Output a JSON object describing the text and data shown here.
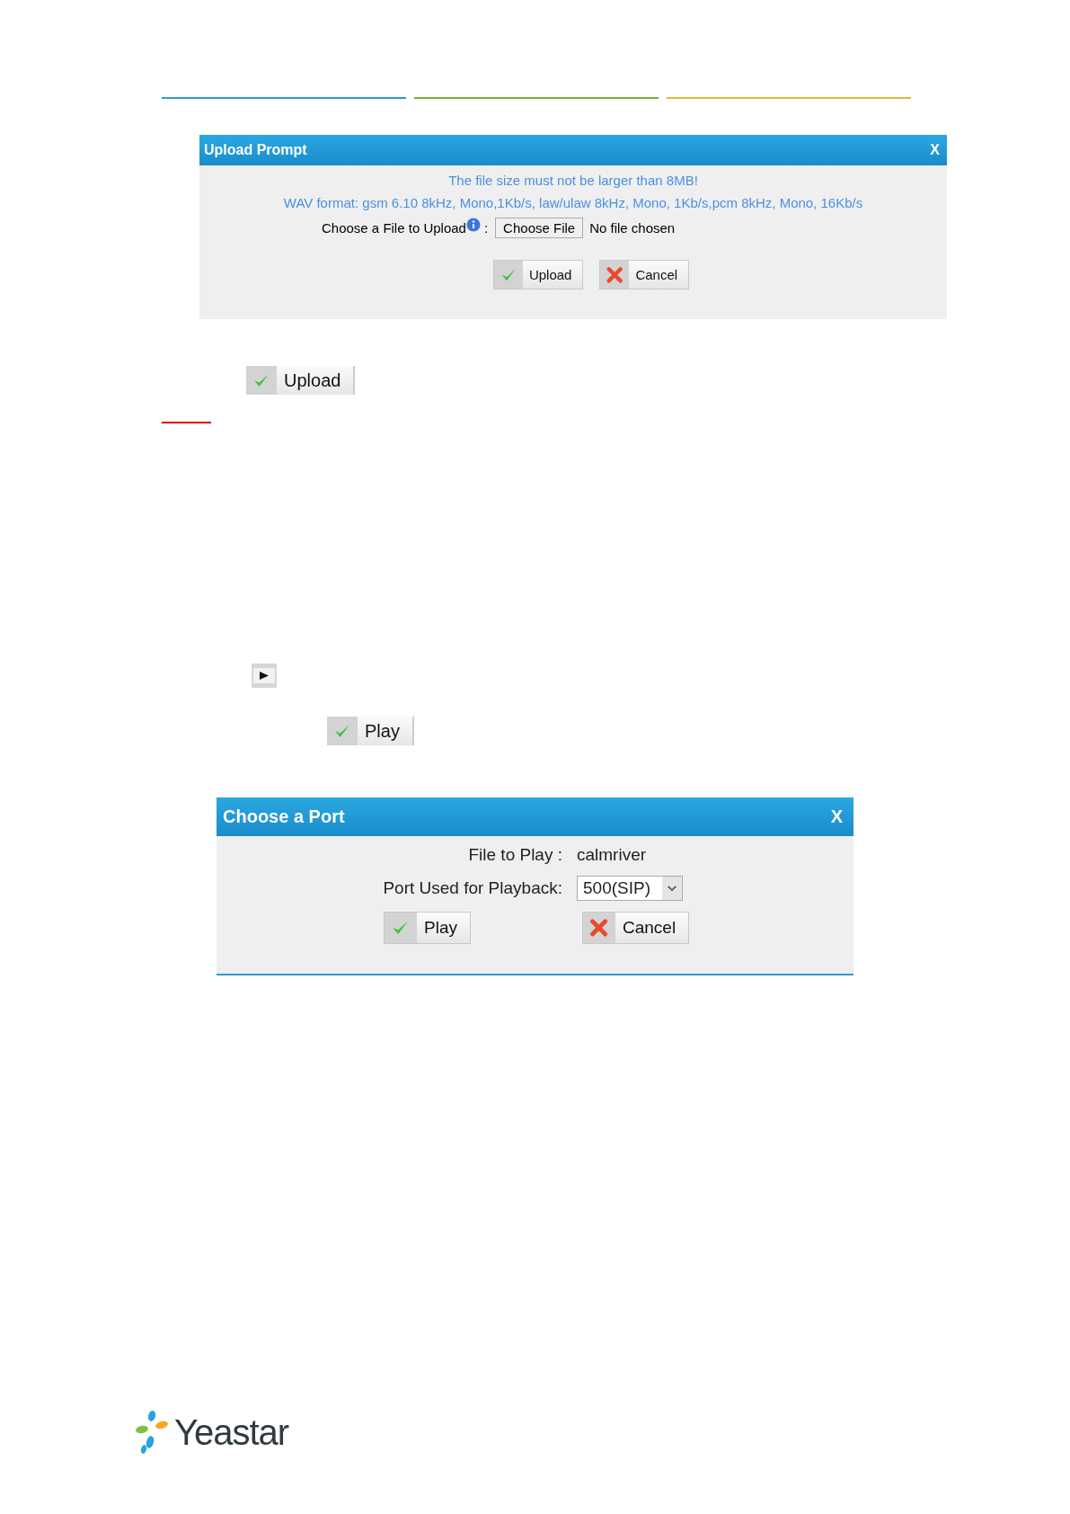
{
  "upload_prompt": {
    "title": "Upload Prompt",
    "close": "X",
    "notes": [
      "The file size must not be larger than 8MB!",
      "WAV format: gsm 6.10 8kHz, Mono,1Kb/s, law/ulaw 8kHz, Mono, 1Kb/s,pcm 8kHz, Mono, 16Kb/s"
    ],
    "file_label": "Choose a File to Upload",
    "separator": ":",
    "choose_button": "Choose File",
    "file_status": "No file chosen",
    "buttons": [
      {
        "kind": "ok",
        "label": "Upload"
      },
      {
        "kind": "cancel",
        "label": "Cancel"
      }
    ]
  },
  "upload_button": {
    "kind": "ok",
    "label": "Upload"
  },
  "play_button": {
    "kind": "ok",
    "label": "Play"
  },
  "choose_port": {
    "title": "Choose a Port",
    "close": "X",
    "file_label": "File to Play :",
    "file_value": "calmriver",
    "port_label": "Port Used for Playback:",
    "port_value": "500(SIP)",
    "buttons": [
      {
        "kind": "ok",
        "label": "Play"
      },
      {
        "kind": "cancel",
        "label": "Cancel"
      }
    ]
  },
  "logo": {
    "text": "Yeastar"
  }
}
